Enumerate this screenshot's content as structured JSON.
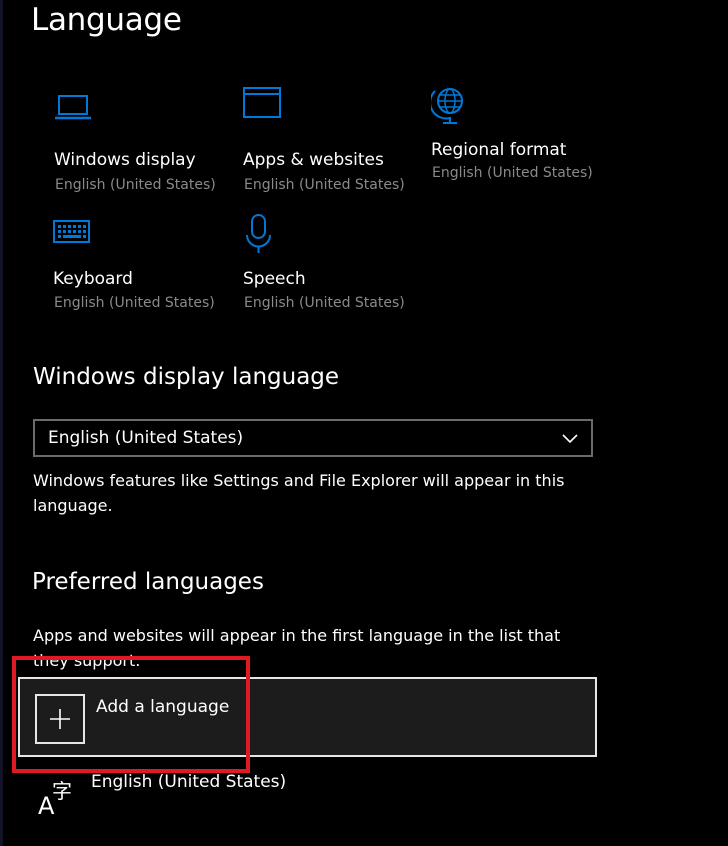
{
  "page": {
    "title": "Language"
  },
  "colors": {
    "accent": "#0078d7",
    "background": "#000000",
    "secondary_text": "#8a8a8a",
    "highlight_box": "#e01a22"
  },
  "tiles": [
    {
      "icon": "laptop-icon",
      "label": "Windows display",
      "value": "English (United States)"
    },
    {
      "icon": "browser-window-icon",
      "label": "Apps & websites",
      "value": "English (United States)"
    },
    {
      "icon": "globe-icon",
      "label": "Regional format",
      "value": "English (United States)"
    },
    {
      "icon": "keyboard-icon",
      "label": "Keyboard",
      "value": "English (United States)"
    },
    {
      "icon": "microphone-icon",
      "label": "Speech",
      "value": "English (United States)"
    }
  ],
  "display_language": {
    "header": "Windows display language",
    "selected": "English (United States)",
    "description": "Windows features like Settings and File Explorer will appear in this language."
  },
  "preferred_languages": {
    "header": "Preferred languages",
    "description": "Apps and websites will appear in the first language in the list that they support.",
    "add_label": "Add a language",
    "items": [
      {
        "icon": "language-icon",
        "name": "English (United States)"
      }
    ]
  }
}
